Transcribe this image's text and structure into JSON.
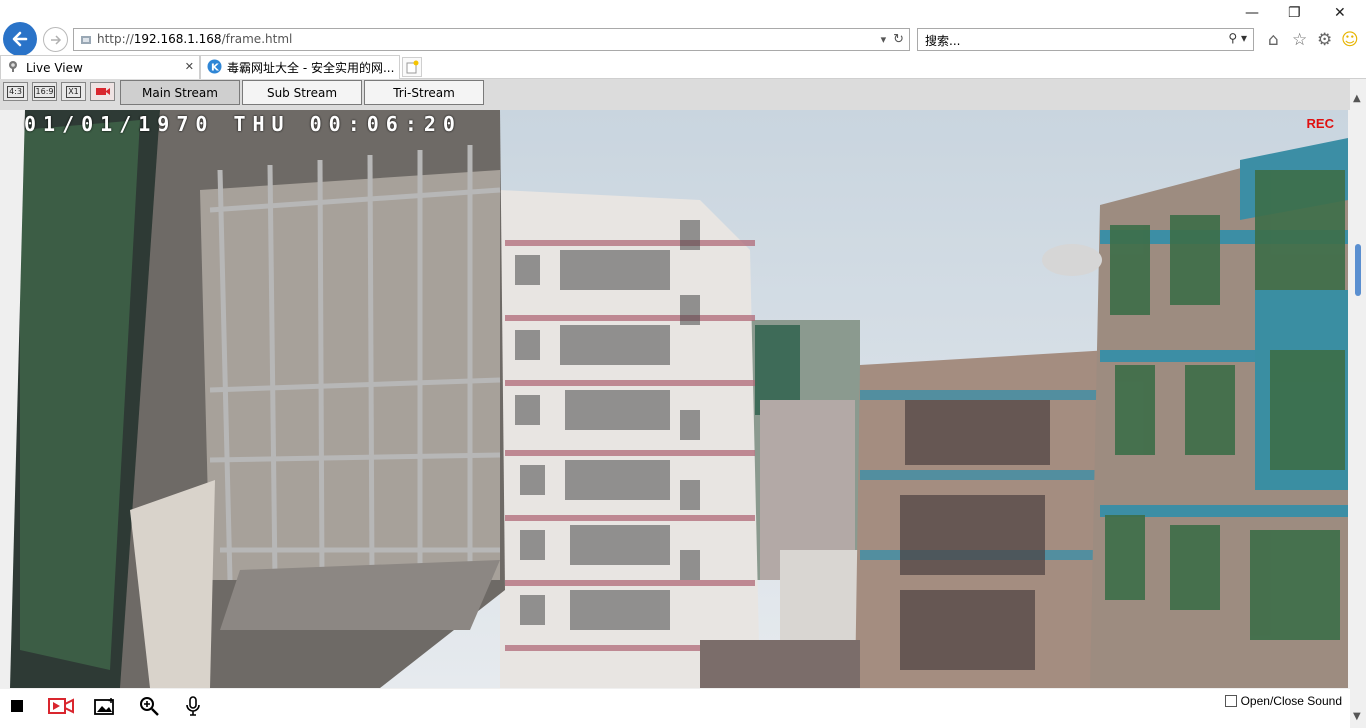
{
  "browser": {
    "url_prefix": "http://",
    "url_host": "192.168.1.168",
    "url_path": "/frame.html",
    "search_placeholder": "搜索...",
    "window_controls": [
      "—",
      "❐",
      "✕"
    ]
  },
  "tabs": [
    {
      "label": "Live View",
      "active": true
    },
    {
      "label": "毒霸网址大全 - 安全实用的网...",
      "active": false
    }
  ],
  "toolbar": {
    "aspect_buttons": [
      "4:3",
      "16:9",
      "X1"
    ],
    "streams": [
      {
        "label": "Main Stream",
        "active": true
      },
      {
        "label": "Sub Stream",
        "active": false
      },
      {
        "label": "Tri-Stream",
        "active": false
      }
    ]
  },
  "video": {
    "osd_timestamp": "01/01/1970 THU 00:06:20",
    "rec_label": "REC"
  },
  "bottom": {
    "sound_label": "Open/Close Sound"
  },
  "colors": {
    "accent": "#2a73c8",
    "rec": "#e01010",
    "record_icon": "#d9262e"
  }
}
